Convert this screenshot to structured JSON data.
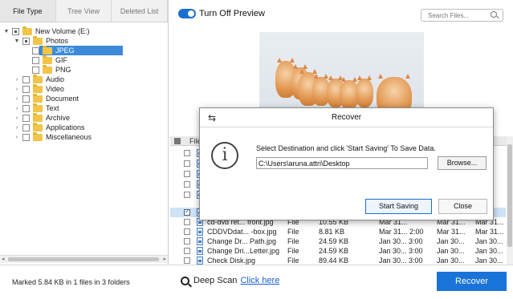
{
  "tabs": [
    {
      "label": "File Type"
    },
    {
      "label": "Tree View"
    },
    {
      "label": "Deleted List"
    }
  ],
  "tree": {
    "items": [
      {
        "label": "New Volume (E:)"
      },
      {
        "label": "Photos"
      },
      {
        "label": "JPEG"
      },
      {
        "label": "GIF"
      },
      {
        "label": "PNG"
      },
      {
        "label": "Audio"
      },
      {
        "label": "Video"
      },
      {
        "label": "Document"
      },
      {
        "label": "Text"
      },
      {
        "label": "Archive"
      },
      {
        "label": "Applications"
      },
      {
        "label": "Miscellaneous"
      }
    ]
  },
  "preview": {
    "toggle_label": "Turn Off Preview",
    "search_placeholder": "Search Files..."
  },
  "file_list": {
    "header_partial": "File",
    "rows": [
      {
        "name": "",
        "type": "",
        "size": "",
        "date1": "",
        "date2": "",
        "date3": ""
      },
      {
        "name": "",
        "type": "",
        "size": "",
        "date1": "",
        "date2": "",
        "date3": ""
      },
      {
        "name": "",
        "type": "",
        "size": "",
        "date1": "",
        "date2": "",
        "date3": ""
      },
      {
        "name": "",
        "type": "",
        "size": "",
        "date1": "",
        "date2": "",
        "date3": ""
      },
      {
        "name": "",
        "type": "",
        "size": "",
        "date1": "",
        "date2": "",
        "date3": ""
      },
      {
        "name": "",
        "type": "",
        "size": "",
        "date1": "",
        "date2": "",
        "date3": ""
      },
      {
        "name": "cd-dvd ret... front.jpg",
        "type": "File",
        "size": "10.55 KB",
        "date1": "Mar 31...",
        "date2": "Mar 31...",
        "date3": "Mar 31..."
      },
      {
        "name": "CDDVDdat... -box.jpg",
        "type": "File",
        "size": "8.81 KB",
        "date1": "Mar 31... 2:00",
        "date2": "Mar 31...",
        "date3": "Mar 31..."
      },
      {
        "name": "Change Dr... Path.jpg",
        "type": "File",
        "size": "24.59 KB",
        "date1": "Jan 30... 3:00",
        "date2": "Jan 30...",
        "date3": "Jan 30..."
      },
      {
        "name": "Change Dri...Letter.jpg",
        "type": "File",
        "size": "24.59 KB",
        "date1": "Jan 30... 3:00",
        "date2": "Jan 30...",
        "date3": "Jan 30..."
      },
      {
        "name": "Check Disk.jpg",
        "type": "File",
        "size": "89.44 KB",
        "date1": "Jan 30... 3:00",
        "date2": "Jan 30...",
        "date3": "Jan 30..."
      }
    ]
  },
  "dialog": {
    "title": "Recover",
    "message": "Select Destination and click 'Start Saving' To Save Data.",
    "path_value": "C:\\Users\\aruna.attri\\Desktop",
    "browse_label": "Browse...",
    "start_label": "Start Saving",
    "close_label": "Close"
  },
  "bottom": {
    "status": "Marked 5.84 KB in 1 files in 3 folders",
    "deep_scan_label": "Deep Scan",
    "click_here": "Click here",
    "recover_label": "Recover"
  },
  "colors": {
    "accent": "#1a73d9",
    "selection": "#3c8ad9",
    "folder": "#f2c54a"
  }
}
